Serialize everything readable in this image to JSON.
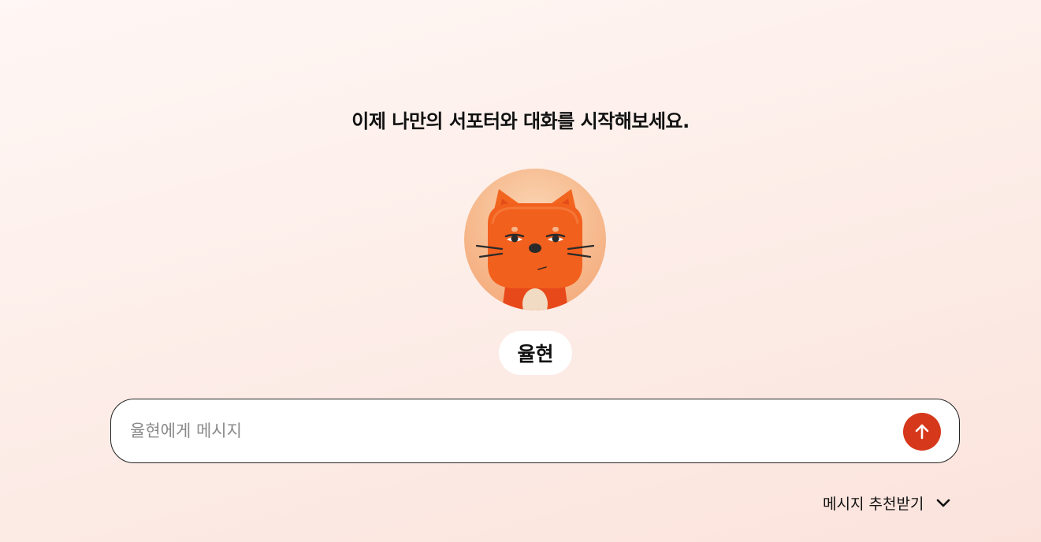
{
  "intro": {
    "title": "이제 나만의 서포터와 대화를 시작해보세요."
  },
  "supporter": {
    "name": "율현",
    "avatar_icon": "orange-cat-avatar"
  },
  "composer": {
    "placeholder": "율현에게 메시지",
    "value": "",
    "send_icon": "arrow-up-icon"
  },
  "recommend": {
    "label": "메시지 추천받기",
    "icon": "chevron-down-icon"
  },
  "colors": {
    "accent": "#d6381b",
    "background_top": "#fff7f5",
    "background_bottom": "#fbe3dc",
    "avatar_bg": "#f6b98d",
    "cat_body": "#f25a1f"
  }
}
